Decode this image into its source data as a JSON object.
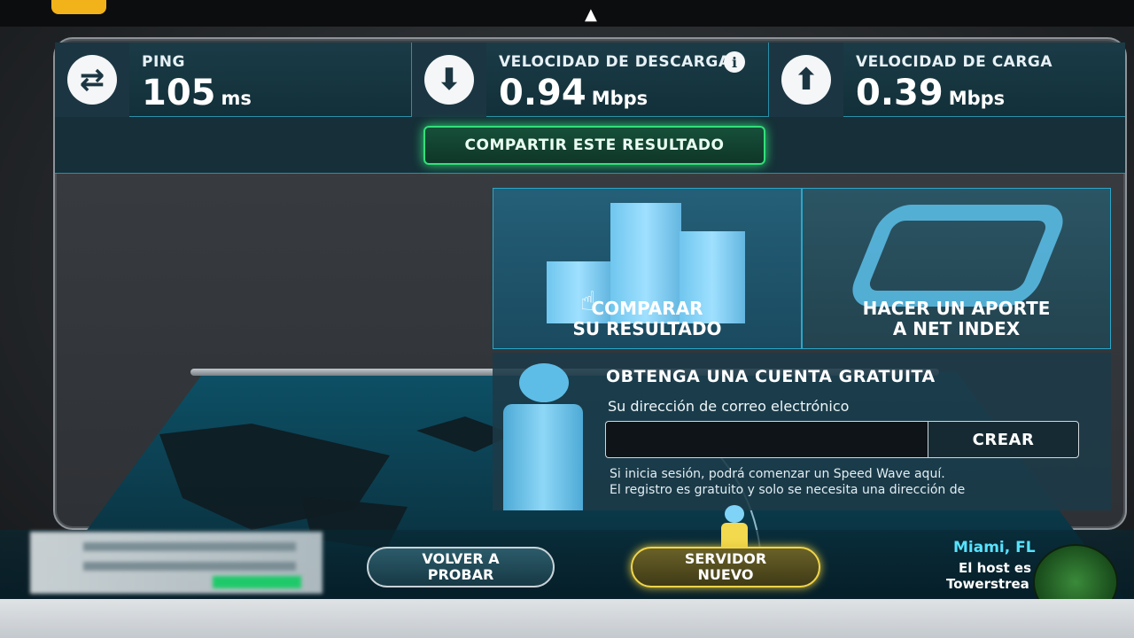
{
  "metrics": {
    "ping": {
      "label": "PING",
      "value": "105",
      "unit": "ms",
      "icon": "ping-arrows-icon"
    },
    "download": {
      "label": "VELOCIDAD DE DESCARGA",
      "value": "0.94",
      "unit": "Mbps",
      "icon": "download-arrow-icon",
      "info_icon": "info-icon"
    },
    "upload": {
      "label": "VELOCIDAD DE CARGA",
      "value": "0.39",
      "unit": "Mbps",
      "icon": "upload-arrow-icon"
    }
  },
  "share": {
    "label": "COMPARTIR ESTE RESULTADO"
  },
  "tiles": {
    "compare": {
      "label": "COMPARAR\nSU RESULTADO"
    },
    "net_index": {
      "label": "HACER UN APORTE\nA NET INDEX"
    }
  },
  "account": {
    "title": "OBTENGA UNA CUENTA GRATUITA",
    "email_label": "Su dirección de correo electrónico",
    "email_value": "",
    "create_label": "CREAR",
    "note_line1": "Si inicia sesión, podrá comenzar un Speed Wave aquí.",
    "note_line2": "El registro es gratuito y solo se necesita una dirección de"
  },
  "actions": {
    "test_again": "VOLVER A\nPROBAR",
    "new_server": "SERVIDOR\nNUEVO"
  },
  "host": {
    "city": "Miami, FL",
    "line1": "El host es",
    "line2": "Towerstrea"
  },
  "colors": {
    "accent_green": "#33e07a",
    "accent_cyan": "#57e3ff",
    "accent_yellow": "#f0d44a",
    "panel_teal": "#1a3b47"
  }
}
